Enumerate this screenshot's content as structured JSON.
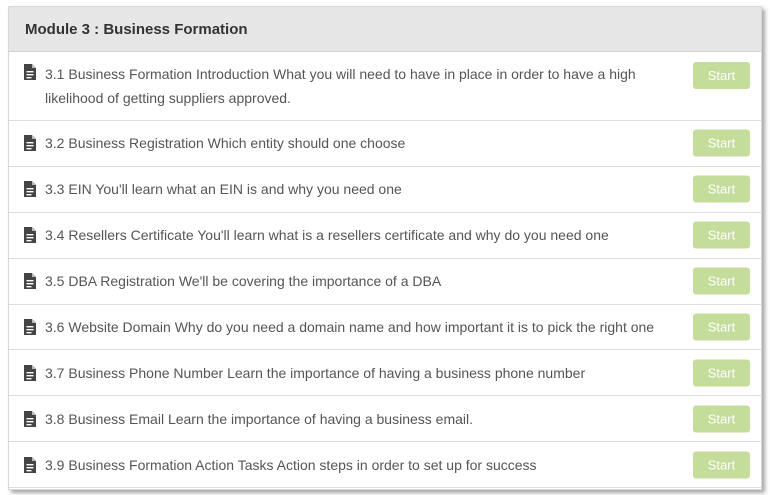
{
  "module": {
    "title": "Module 3 : Business Formation"
  },
  "lessons": [
    {
      "text": "3.1 Business Formation Introduction What you will need to have in place in order to have a high likelihood of getting suppliers approved.",
      "start_label": "Start"
    },
    {
      "text": "3.2 Business Registration Which entity should one choose",
      "start_label": "Start"
    },
    {
      "text": "3.3 EIN You'll learn what an EIN is and why you need one",
      "start_label": "Start"
    },
    {
      "text": "3.4 Resellers Certificate You'll learn what is a resellers certificate and why do you need one",
      "start_label": "Start"
    },
    {
      "text": "3.5 DBA Registration We'll be covering the importance of a DBA",
      "start_label": "Start"
    },
    {
      "text": "3.6 Website Domain Why do you need a domain name and how important it is to pick the right one",
      "start_label": "Start"
    },
    {
      "text": "3.7 Business Phone Number Learn the importance of having a business phone number",
      "start_label": "Start"
    },
    {
      "text": "3.8 Business Email Learn the importance of having a business email.",
      "start_label": "Start"
    },
    {
      "text": "3.9 Business Formation Action Tasks Action steps in order to set up for success",
      "start_label": "Start"
    }
  ],
  "icons": {
    "lesson_icon": "document-icon"
  },
  "colors": {
    "header_bg": "#e6e6e6",
    "start_button_bg": "#c5dd9b",
    "text": "#555555"
  }
}
